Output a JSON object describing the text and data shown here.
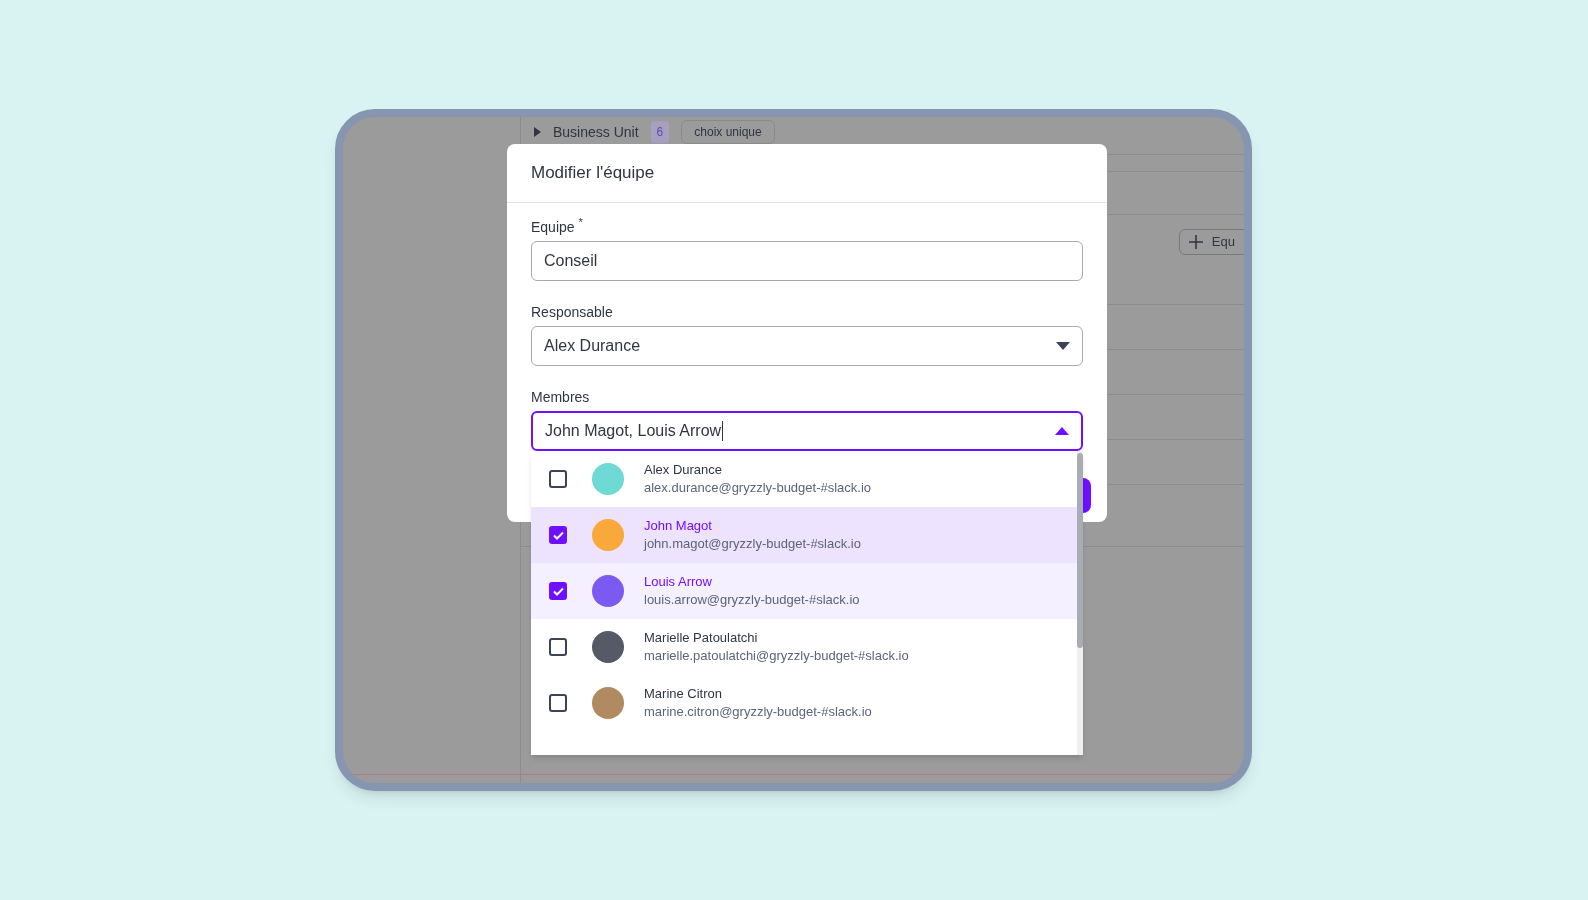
{
  "background": {
    "section": {
      "label": "Business Unit",
      "count": "6",
      "badge": "choix unique"
    },
    "add_button": {
      "label": "Equ"
    }
  },
  "modal": {
    "title": "Modifier l'équipe",
    "fields": [
      {
        "kind": "text",
        "label": "Equipe",
        "required_mark": "*",
        "value": "Conseil",
        "focused": false
      },
      {
        "kind": "select",
        "label": "Responsable",
        "value": "Alex Durance",
        "focused": false,
        "expanded": false
      },
      {
        "kind": "select",
        "label": "Membres",
        "value": "John Magot, Louis Arrow",
        "focused": true,
        "expanded": true
      }
    ],
    "options": [
      {
        "name": "Alex Durance",
        "email": "alex.durance@gryzzly-budget-#slack.io",
        "checked": false,
        "hovered": false,
        "color": "#6fd9d4"
      },
      {
        "name": "John Magot",
        "email": "john.magot@gryzzly-budget-#slack.io",
        "checked": true,
        "hovered": true,
        "color": "#f8a93a"
      },
      {
        "name": "Louis Arrow",
        "email": "louis.arrow@gryzzly-budget-#slack.io",
        "checked": true,
        "hovered": false,
        "color": "#7a5af0"
      },
      {
        "name": "Marielle Patoulatchi",
        "email": "marielle.patoulatchi@gryzzly-budget-#slack.io",
        "checked": false,
        "hovered": false,
        "color": "#555a66"
      },
      {
        "name": "Marine Citron",
        "email": "marine.citron@gryzzly-budget-#slack.io",
        "checked": false,
        "hovered": false,
        "color": "#b08a60"
      }
    ]
  }
}
